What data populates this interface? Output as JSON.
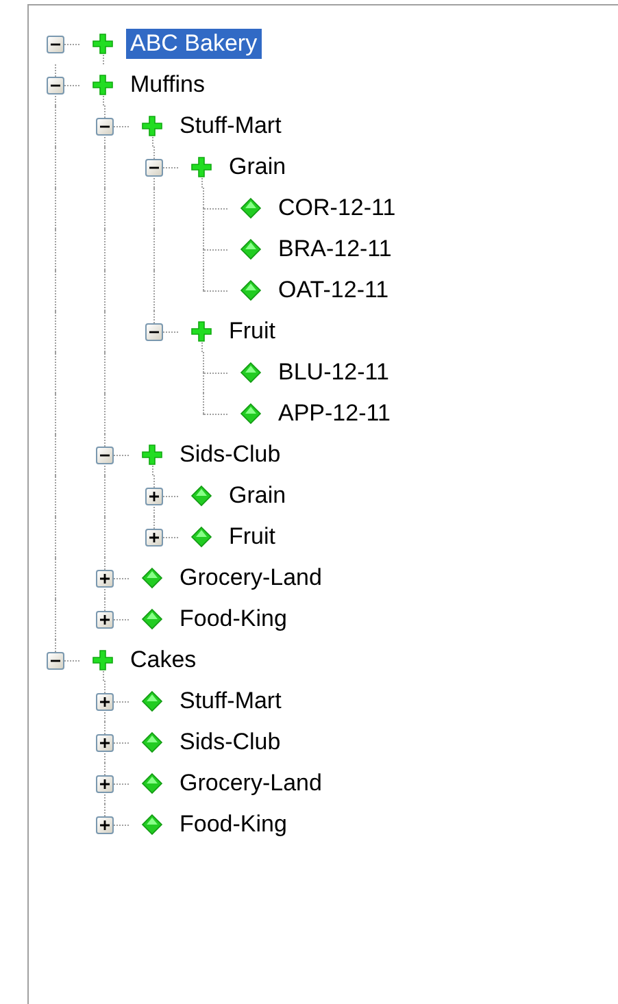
{
  "tree": [
    {
      "label": "ABC Bakery",
      "kind": "branch",
      "expanded": true,
      "selected": true,
      "children": [
        {
          "label": "Muffins",
          "kind": "branch",
          "expanded": true,
          "selected": false,
          "children": [
            {
              "label": "Stuff-Mart",
              "kind": "branch",
              "expanded": true,
              "selected": false,
              "children": [
                {
                  "label": "Grain",
                  "kind": "branch",
                  "expanded": true,
                  "selected": false,
                  "children": [
                    {
                      "label": "COR-12-11",
                      "kind": "leaf",
                      "selected": false
                    },
                    {
                      "label": "BRA-12-11",
                      "kind": "leaf",
                      "selected": false
                    },
                    {
                      "label": "OAT-12-11",
                      "kind": "leaf",
                      "selected": false
                    }
                  ]
                },
                {
                  "label": "Fruit",
                  "kind": "branch",
                  "expanded": true,
                  "selected": false,
                  "children": [
                    {
                      "label": "BLU-12-11",
                      "kind": "leaf",
                      "selected": false
                    },
                    {
                      "label": "APP-12-11",
                      "kind": "leaf",
                      "selected": false
                    }
                  ]
                }
              ]
            },
            {
              "label": "Sids-Club",
              "kind": "branch",
              "expanded": true,
              "selected": false,
              "children": [
                {
                  "label": "Grain",
                  "kind": "branch",
                  "expanded": false,
                  "selected": false
                },
                {
                  "label": "Fruit",
                  "kind": "branch",
                  "expanded": false,
                  "selected": false
                }
              ]
            },
            {
              "label": "Grocery-Land",
              "kind": "branch",
              "expanded": false,
              "selected": false
            },
            {
              "label": "Food-King",
              "kind": "branch",
              "expanded": false,
              "selected": false
            }
          ]
        },
        {
          "label": "Cakes",
          "kind": "branch",
          "expanded": true,
          "selected": false,
          "children": [
            {
              "label": "Stuff-Mart",
              "kind": "branch",
              "expanded": false,
              "selected": false
            },
            {
              "label": "Sids-Club",
              "kind": "branch",
              "expanded": false,
              "selected": false
            },
            {
              "label": "Grocery-Land",
              "kind": "branch",
              "expanded": false,
              "selected": false
            },
            {
              "label": "Food-King",
              "kind": "branch",
              "expanded": false,
              "selected": false
            }
          ]
        }
      ]
    }
  ]
}
